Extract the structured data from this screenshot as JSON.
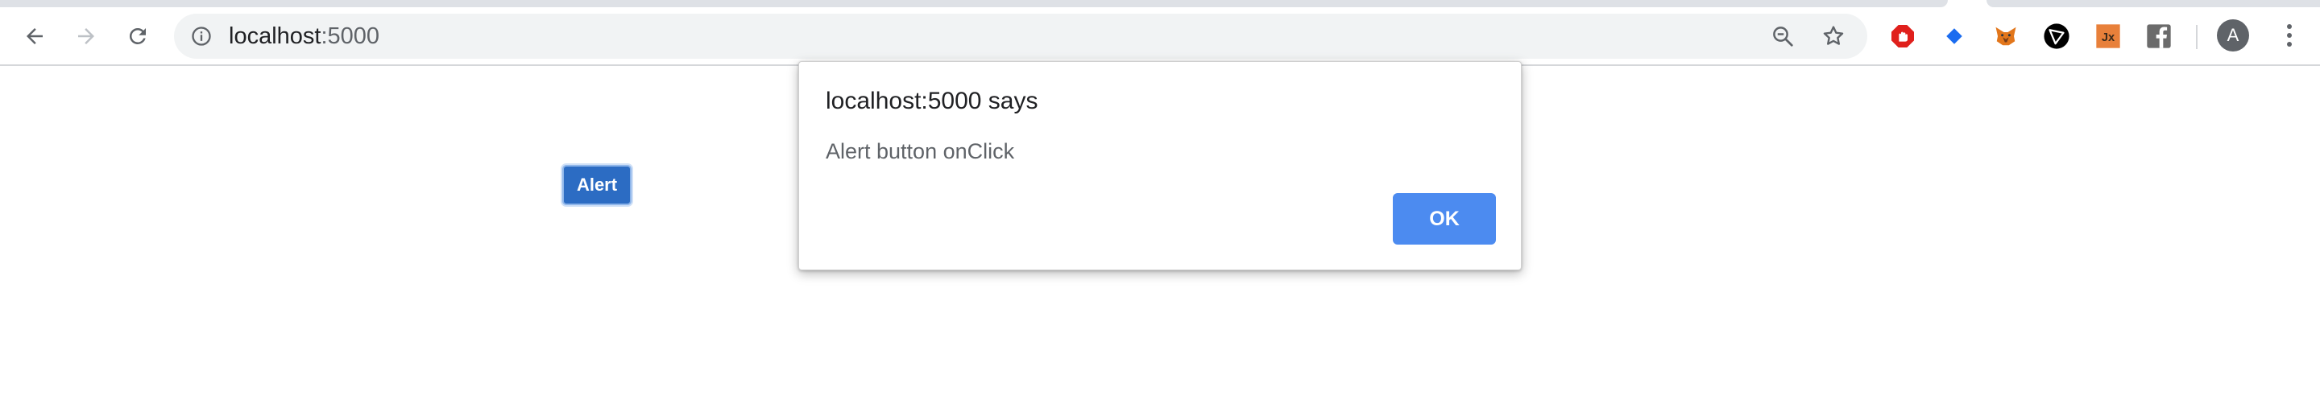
{
  "browser": {
    "url_host": "localhost",
    "url_port": ":5000",
    "avatar_letter": "A",
    "extensions": [
      {
        "name": "adblock-icon",
        "color": "#e0201c"
      },
      {
        "name": "diamond-icon",
        "color": "#1a6cf0"
      },
      {
        "name": "metamask-fox-icon",
        "color": "#e2761b"
      },
      {
        "name": "tron-icon",
        "color": "#000000"
      },
      {
        "name": "jx-icon",
        "color": "#e8803a",
        "label": "Jx"
      },
      {
        "name": "facebook-icon",
        "color": "#6b6b6b"
      }
    ]
  },
  "page": {
    "alert_button_label": "Alert",
    "alert_button_color": "#2c6cc3"
  },
  "dialog": {
    "title": "localhost:5000 says",
    "message": "Alert button onClick",
    "ok_label": "OK",
    "ok_color": "#4c8bf0"
  }
}
